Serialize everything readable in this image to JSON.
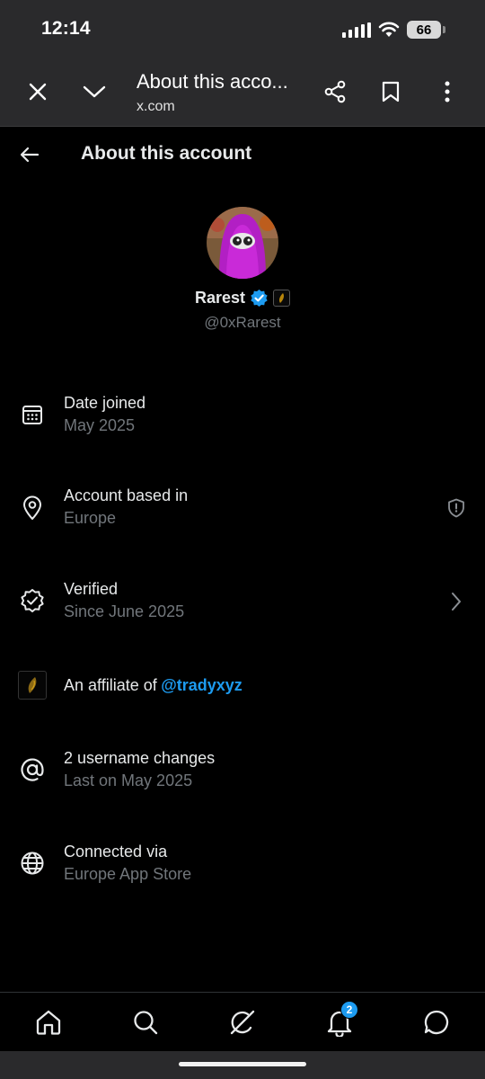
{
  "status_bar": {
    "time": "12:14",
    "battery": "66"
  },
  "browser": {
    "page_title": "About this acco...",
    "url": "x.com"
  },
  "header": {
    "title": "About this account"
  },
  "profile": {
    "display_name": "Rarest",
    "handle": "@0xRarest"
  },
  "info": {
    "date_joined": {
      "label": "Date joined",
      "value": "May 2025"
    },
    "based_in": {
      "label": "Account based in",
      "value": "Europe"
    },
    "verified": {
      "label": "Verified",
      "value": "Since June 2025"
    },
    "affiliate": {
      "prefix": "An affiliate of",
      "handle": "@tradyxyz"
    },
    "username_changes": {
      "label": "2 username changes",
      "value": "Last on May 2025"
    },
    "connected_via": {
      "label": "Connected via",
      "value": "Europe App Store"
    }
  },
  "bottom_nav": {
    "notifications_badge": "2"
  },
  "colors": {
    "accent": "#1d9bf0",
    "muted_text": "#71767b",
    "primary_text": "#e7e9ea",
    "background": "#000000",
    "browser_chrome": "#2a2a2c"
  }
}
